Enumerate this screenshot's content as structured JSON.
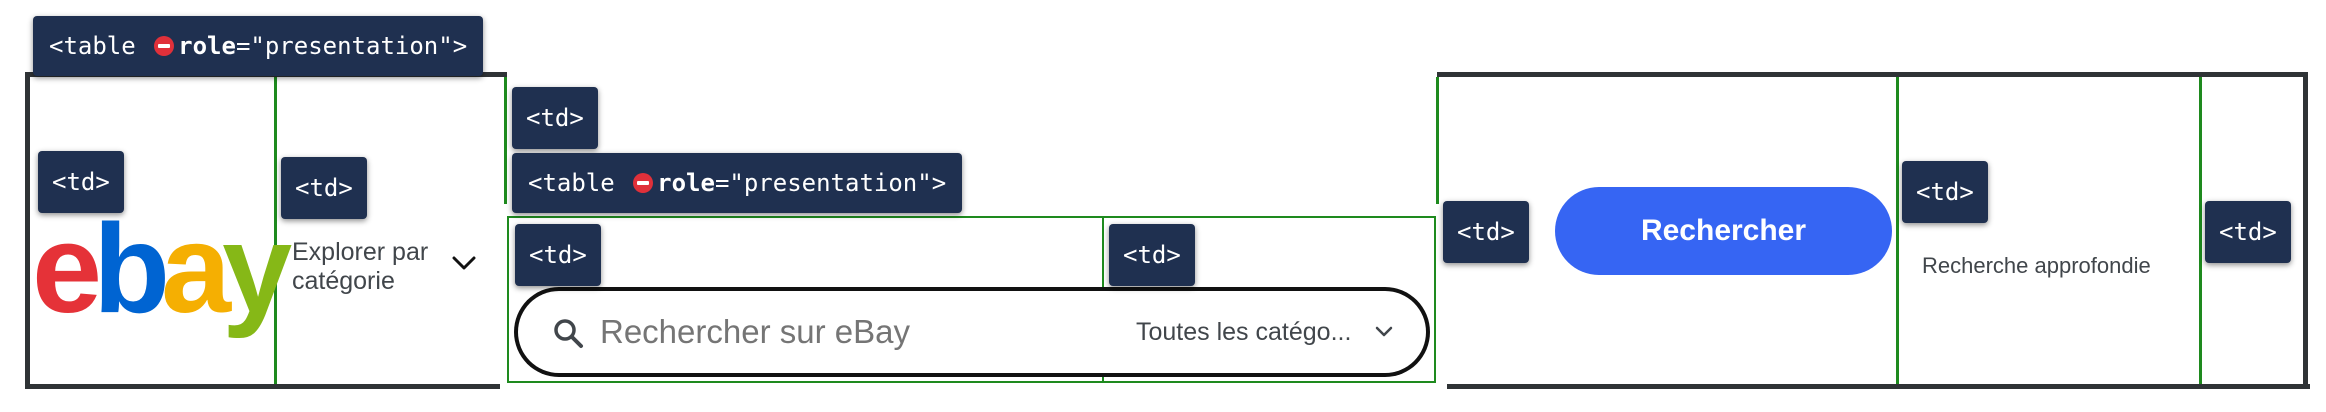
{
  "overlays": {
    "outer_table": {
      "prefix": "<table ",
      "attr": "role",
      "suffix": "=\"presentation\">"
    },
    "logo_td": "<td>",
    "category_td": "<td>",
    "search_wrap_td": "<td>",
    "inner_table": {
      "prefix": "<table ",
      "attr": "role",
      "suffix": "=\"presentation\">"
    },
    "input_td": "<td>",
    "select_td": "<td>",
    "button_td": "<td>",
    "advanced_td": "<td>",
    "last_td": "<td>"
  },
  "logo": {
    "letters": [
      "e",
      "b",
      "a",
      "y"
    ],
    "colors": [
      "#e53238",
      "#0064d2",
      "#f5af02",
      "#86b817"
    ]
  },
  "category_nav": {
    "label_line1": "Explorer par",
    "label_line2": "catégorie",
    "icon": "chevron-down-icon"
  },
  "search": {
    "placeholder": "Rechercher sur eBay",
    "icon": "search-icon"
  },
  "category_select": {
    "selected": "Toutes les catégo...",
    "icon": "chevron-down-icon"
  },
  "search_button": {
    "label": "Rechercher",
    "color": "#3665f3"
  },
  "advanced_search": {
    "label": "Recherche approfondie"
  },
  "colors": {
    "frame": "#2f3336",
    "cell_outline": "#1e8a1e",
    "overlay_bg": "#1f3050"
  }
}
